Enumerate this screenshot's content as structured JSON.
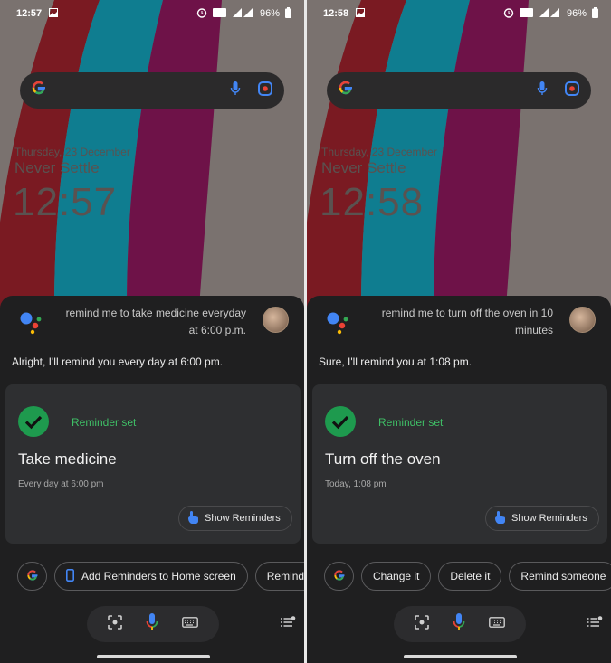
{
  "panels": [
    {
      "status": {
        "time": "12:57",
        "battery": "96%"
      },
      "lockscreen": {
        "date": "Thursday, 23 December",
        "tagline": "Never Settle",
        "clock": "12:57"
      },
      "assistant": {
        "query": "remind me to take medicine everyday at 6:00 p.m.",
        "response": "Alright, I'll remind you every day at 6:00 pm.",
        "card": {
          "status": "Reminder set",
          "title": "Take medicine",
          "time": "Every day at 6:00 pm",
          "button": "Show Reminders"
        },
        "chips": [
          "Add Reminders to Home screen",
          "Remind me"
        ]
      }
    },
    {
      "status": {
        "time": "12:58",
        "battery": "96%"
      },
      "lockscreen": {
        "date": "Thursday, 23 December",
        "tagline": "Never Settle",
        "clock": "12:58"
      },
      "assistant": {
        "query": "remind me to turn off the oven in 10 minutes",
        "response": "Sure, I'll remind you at 1:08 pm.",
        "card": {
          "status": "Reminder set",
          "title": "Turn off the oven",
          "time": "Today, 1:08 pm",
          "button": "Show Reminders"
        },
        "chips": [
          "Change it",
          "Delete it",
          "Remind someone"
        ]
      }
    }
  ],
  "icons": {
    "google": "google-g-icon",
    "mic": "mic-icon",
    "lens": "lens-icon",
    "keyboard": "keyboard-icon",
    "check": "check-icon",
    "tap": "tap-hand-icon",
    "phone": "phone-icon",
    "list": "list-icon",
    "alarm": "alarm-icon",
    "wifi": "wifi-icon",
    "signal": "signal-icon",
    "battery": "battery-icon",
    "image": "image-icon"
  },
  "colors": {
    "sheet_bg": "#1f1f20",
    "card_bg": "#2e2f31",
    "accent_green": "#3fbf66",
    "google_blue": "#4285f4",
    "google_red": "#ea4335",
    "google_yellow": "#fbbc05",
    "google_green": "#34a853",
    "stripe_red": "#7a1a22",
    "stripe_teal": "#0f7d90",
    "stripe_purple": "#6e1248"
  }
}
